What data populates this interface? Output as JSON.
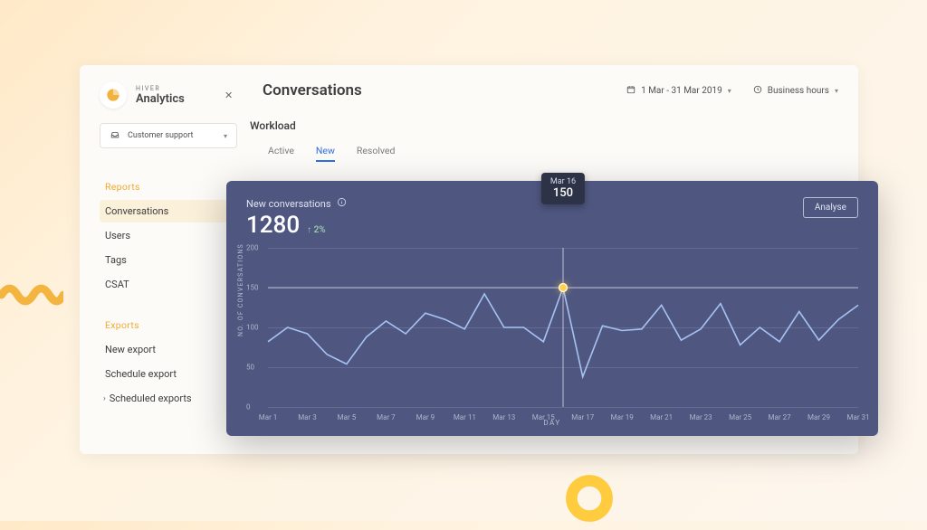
{
  "brand": {
    "small": "HIVER",
    "big": "Analytics"
  },
  "page_title": "Conversations",
  "toolbar": {
    "date_range": "1 Mar - 31 Mar 2019",
    "hours_mode": "Business hours"
  },
  "selector": {
    "current": "Customer support"
  },
  "nav": {
    "reports_heading": "Reports",
    "reports": [
      "Conversations",
      "Users",
      "Tags",
      "CSAT"
    ],
    "exports_heading": "Exports",
    "exports": [
      "New export",
      "Schedule export",
      "Scheduled exports"
    ]
  },
  "section": {
    "title": "Workload",
    "tabs": [
      "Active",
      "New",
      "Resolved"
    ],
    "active_tab_index": 1
  },
  "chart": {
    "title": "New conversations",
    "metric_value": "1280",
    "delta": "2%",
    "delta_dir": "up",
    "analyse_label": "Analyse",
    "yaxis_label": "NO. OF CONVERSATIONS",
    "xaxis_label": "DAY",
    "tooltip": {
      "label": "Mar 16",
      "value": "150"
    },
    "hover_index": 15
  },
  "chart_data": {
    "type": "line",
    "title": "New conversations",
    "xlabel": "DAY",
    "ylabel": "NO. OF CONVERSATIONS",
    "ylim": [
      0,
      200
    ],
    "y_ticks": [
      0,
      50,
      100,
      150,
      200
    ],
    "categories": [
      "Mar 1",
      "Mar 2",
      "Mar 3",
      "Mar 4",
      "Mar 5",
      "Mar 6",
      "Mar 7",
      "Mar 8",
      "Mar 9",
      "Mar 10",
      "Mar 11",
      "Mar 12",
      "Mar 13",
      "Mar 14",
      "Mar 15",
      "Mar 16",
      "Mar 17",
      "Mar 18",
      "Mar 19",
      "Mar 20",
      "Mar 21",
      "Mar 22",
      "Mar 23",
      "Mar 24",
      "Mar 25",
      "Mar 26",
      "Mar 27",
      "Mar 28",
      "Mar 29",
      "Mar 30",
      "Mar 31"
    ],
    "x_tick_every": 2,
    "values": [
      82,
      100,
      92,
      66,
      54,
      88,
      108,
      92,
      118,
      110,
      98,
      142,
      100,
      100,
      82,
      150,
      38,
      102,
      96,
      98,
      128,
      84,
      98,
      130,
      78,
      100,
      82,
      120,
      84,
      110,
      128
    ]
  },
  "colors": {
    "card_bg": "#4f5781",
    "series": "#a7c2f2",
    "accent": "#f0a930"
  }
}
